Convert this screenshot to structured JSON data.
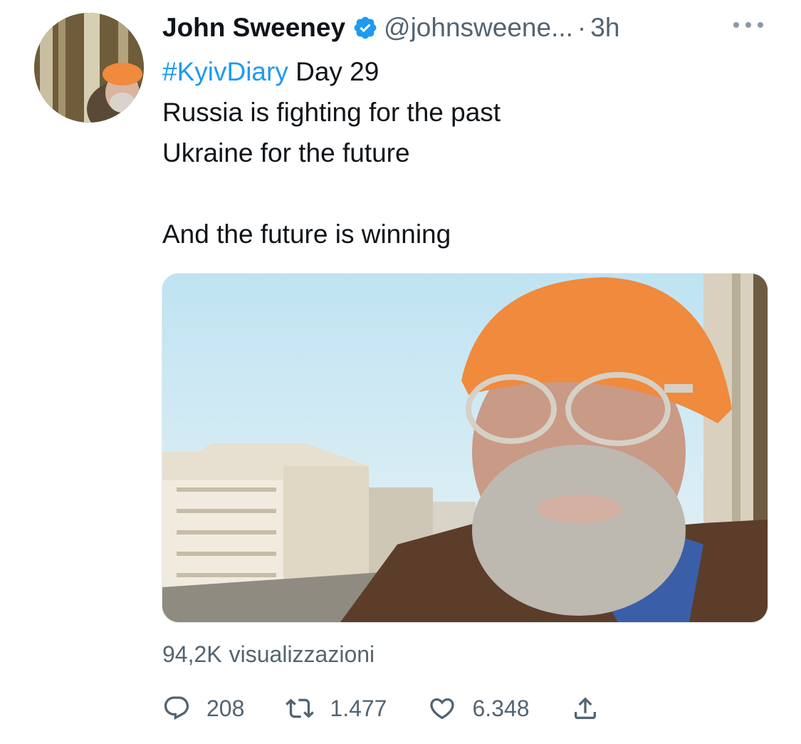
{
  "author": {
    "name": "John Sweeney",
    "handle": "@johnsweene...",
    "separator": "·",
    "time": "3h",
    "verified": true
  },
  "tweet": {
    "hashtag": "#KyivDiary",
    "line1_rest": " Day 29",
    "line2": "Russia is fighting for the past",
    "line3": "Ukraine for the future",
    "line5": "And the future is winning"
  },
  "stats": {
    "views_count": "94,2K",
    "views_label": "visualizzazioni",
    "replies": "208",
    "retweets": "1.477",
    "likes": "6.348"
  },
  "icons": {
    "verified": "verified-badge-icon",
    "more": "more-options-icon",
    "reply": "reply-icon",
    "retweet": "retweet-icon",
    "like": "heart-icon",
    "share": "share-icon"
  },
  "colors": {
    "link": "#1d9bf0",
    "secondary": "#536471",
    "text": "#0f1419"
  }
}
